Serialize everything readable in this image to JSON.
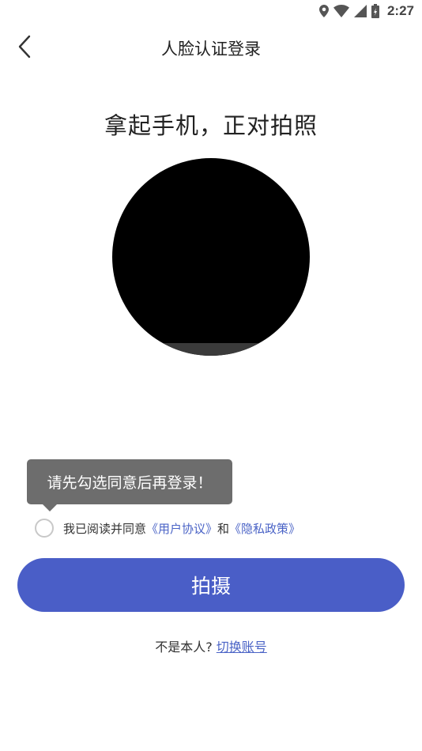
{
  "status_bar": {
    "time": "2:27",
    "icons": [
      "location-icon",
      "wifi-icon",
      "signal-icon",
      "battery-icon"
    ]
  },
  "nav": {
    "title": "人脸认证登录",
    "back_icon": "chevron-left-icon"
  },
  "prompt": "拿起手机，正对拍照",
  "tooltip": "请先勾选同意后再登录！",
  "agreement": {
    "prefix": "我已阅读并同意",
    "user_agreement": "《用户协议》",
    "and": "和",
    "privacy_policy": "《隐私政策》",
    "checked": false
  },
  "shoot_button": "拍摄",
  "switch_account": {
    "prefix": "不是本人?",
    "link": "切换账号"
  },
  "colors": {
    "primary": "#4a5ec7",
    "link": "#4a63c6",
    "tooltip_bg": "#6d6d6d"
  }
}
